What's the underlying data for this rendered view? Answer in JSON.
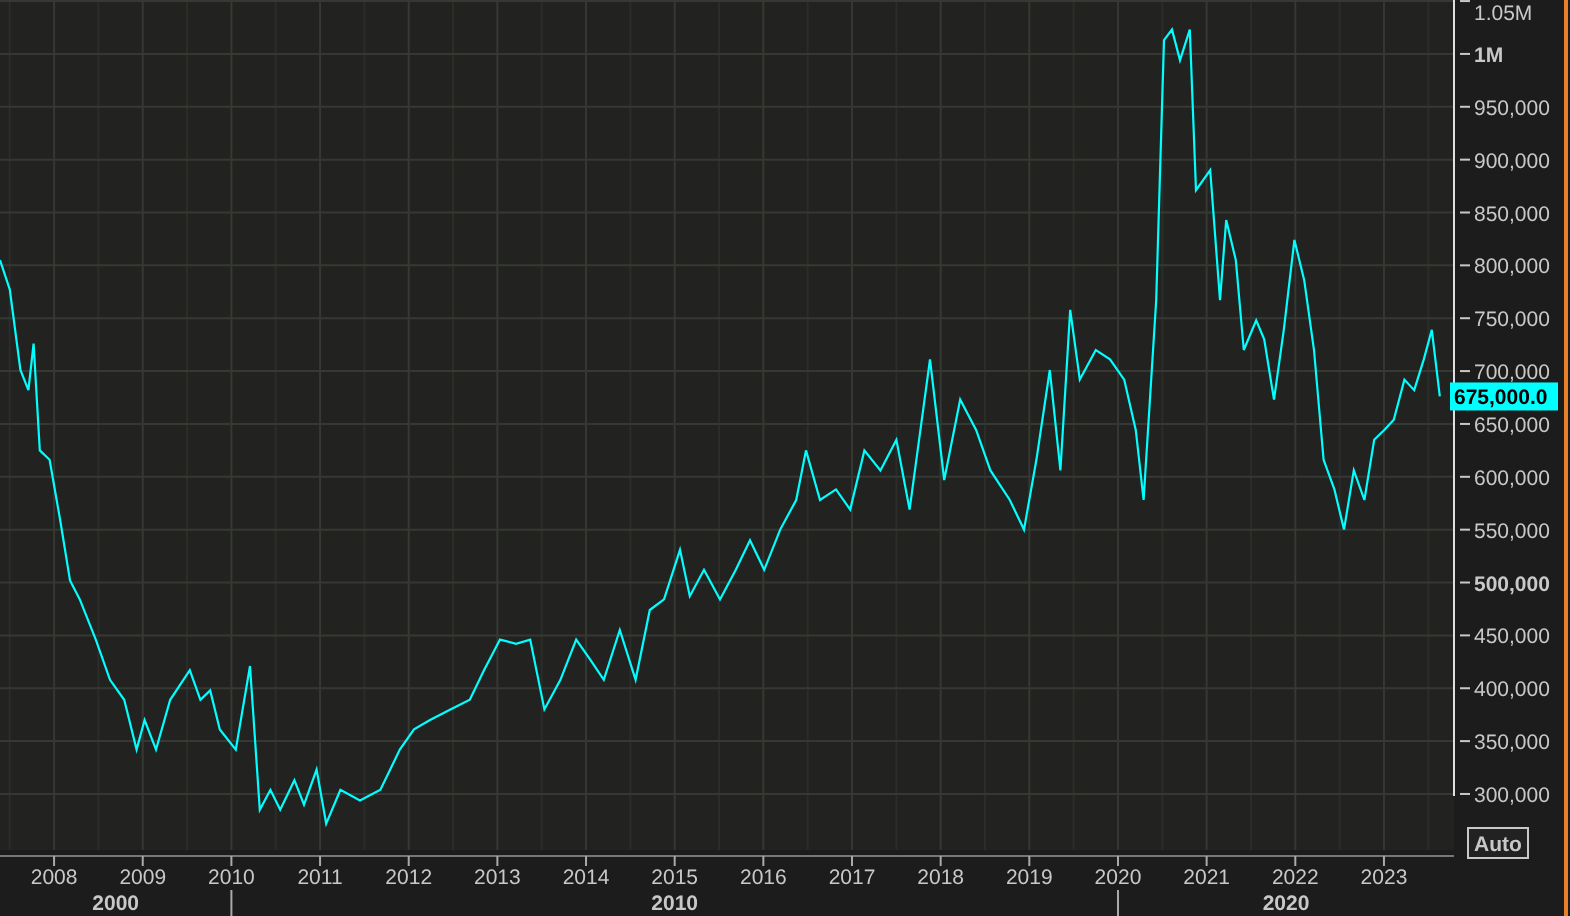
{
  "chart": {
    "chart_data": {
      "type": "line",
      "grid": true,
      "xlim": [
        2007.39,
        2023.79
      ],
      "ylim": [
        247000,
        1051000
      ],
      "xticks": [
        2008,
        2009,
        2010,
        2011,
        2012,
        2013,
        2014,
        2015,
        2016,
        2017,
        2018,
        2019,
        2020,
        2021,
        2022,
        2023
      ],
      "yticks": [
        {
          "value": 300000,
          "label": "300,000"
        },
        {
          "value": 350000,
          "label": "350,000"
        },
        {
          "value": 400000,
          "label": "400,000"
        },
        {
          "value": 450000,
          "label": "450,000"
        },
        {
          "value": 500000,
          "label": "500,000"
        },
        {
          "value": 550000,
          "label": "550,000"
        },
        {
          "value": 600000,
          "label": "600,000"
        },
        {
          "value": 650000,
          "label": "650,000"
        },
        {
          "value": 700000,
          "label": "700,000"
        },
        {
          "value": 750000,
          "label": "750,000"
        },
        {
          "value": 800000,
          "label": "800,000"
        },
        {
          "value": 850000,
          "label": "850,000"
        },
        {
          "value": 900000,
          "label": "900,000"
        },
        {
          "value": 950000,
          "label": "950,000"
        },
        {
          "value": 1000000,
          "label": "1M"
        },
        {
          "value": 1050000,
          "label": "1.05M"
        }
      ],
      "x": [
        2007.39,
        2007.5,
        2007.62,
        2007.71,
        2007.77,
        2007.84,
        2007.95,
        2008.07,
        2008.18,
        2008.29,
        2008.47,
        2008.63,
        2008.79,
        2008.93,
        2009.02,
        2009.15,
        2009.31,
        2009.53,
        2009.65,
        2009.76,
        2009.87,
        2010.05,
        2010.21,
        2010.32,
        2010.44,
        2010.55,
        2010.71,
        2010.82,
        2010.96,
        2011.07,
        2011.23,
        2011.45,
        2011.68,
        2011.9,
        2012.06,
        2012.24,
        2012.47,
        2012.69,
        2012.85,
        2013.03,
        2013.21,
        2013.37,
        2013.53,
        2013.71,
        2013.89,
        2014.05,
        2014.2,
        2014.38,
        2014.56,
        2014.72,
        2014.88,
        2015.06,
        2015.17,
        2015.33,
        2015.51,
        2015.69,
        2015.85,
        2016.01,
        2016.19,
        2016.37,
        2016.48,
        2016.64,
        2016.82,
        2016.98,
        2017.14,
        2017.32,
        2017.5,
        2017.65,
        2017.88,
        2018.04,
        2018.22,
        2018.4,
        2018.56,
        2018.78,
        2018.94,
        2019.08,
        2019.23,
        2019.35,
        2019.46,
        2019.57,
        2019.75,
        2019.91,
        2020.07,
        2020.2,
        2020.29,
        2020.43,
        2020.52,
        2020.61,
        2020.7,
        2020.81,
        2020.88,
        2021.04,
        2021.15,
        2021.22,
        2021.33,
        2021.42,
        2021.56,
        2021.65,
        2021.76,
        2021.87,
        2021.99,
        2022.1,
        2022.21,
        2022.32,
        2022.44,
        2022.55,
        2022.66,
        2022.78,
        2022.89,
        2023.0,
        2023.11,
        2023.23,
        2023.34,
        2023.45,
        2023.54,
        2023.63
      ],
      "series": [
        {
          "color": "#00ffff",
          "values": [
            805000,
            777000,
            701000,
            682000,
            726000,
            625000,
            616000,
            559000,
            502000,
            484000,
            446000,
            408000,
            389000,
            342000,
            370000,
            342000,
            389000,
            417000,
            389000,
            398000,
            361000,
            342000,
            421000,
            285000,
            304000,
            285000,
            313000,
            290000,
            323000,
            272000,
            304000,
            294000,
            304000,
            342000,
            361000,
            370000,
            380000,
            389000,
            417000,
            446000,
            442000,
            446000,
            380000,
            408000,
            446000,
            427000,
            408000,
            455000,
            408000,
            474000,
            484000,
            531000,
            487000,
            512000,
            484000,
            512000,
            540000,
            512000,
            550000,
            578000,
            625000,
            578000,
            588000,
            569000,
            625000,
            606000,
            635000,
            569000,
            711000,
            597000,
            673000,
            644000,
            606000,
            578000,
            550000,
            616000,
            701000,
            606000,
            758000,
            692000,
            720000,
            711000,
            692000,
            644000,
            578000,
            767000,
            1013000,
            1023000,
            994000,
            1023000,
            871000,
            890000,
            767000,
            843000,
            805000,
            720000,
            748000,
            730000,
            673000,
            739000,
            824000,
            786000,
            720000,
            616000,
            588000,
            550000,
            606000,
            578000,
            635000,
            644000,
            654000,
            692000,
            682000,
            711000,
            739000,
            676000
          ]
        }
      ]
    },
    "x_groups": [
      {
        "label": "2000"
      },
      {
        "label": "2010"
      },
      {
        "label": "2020"
      }
    ],
    "current_value_label": "675,000.0",
    "scale_button": "Auto"
  }
}
